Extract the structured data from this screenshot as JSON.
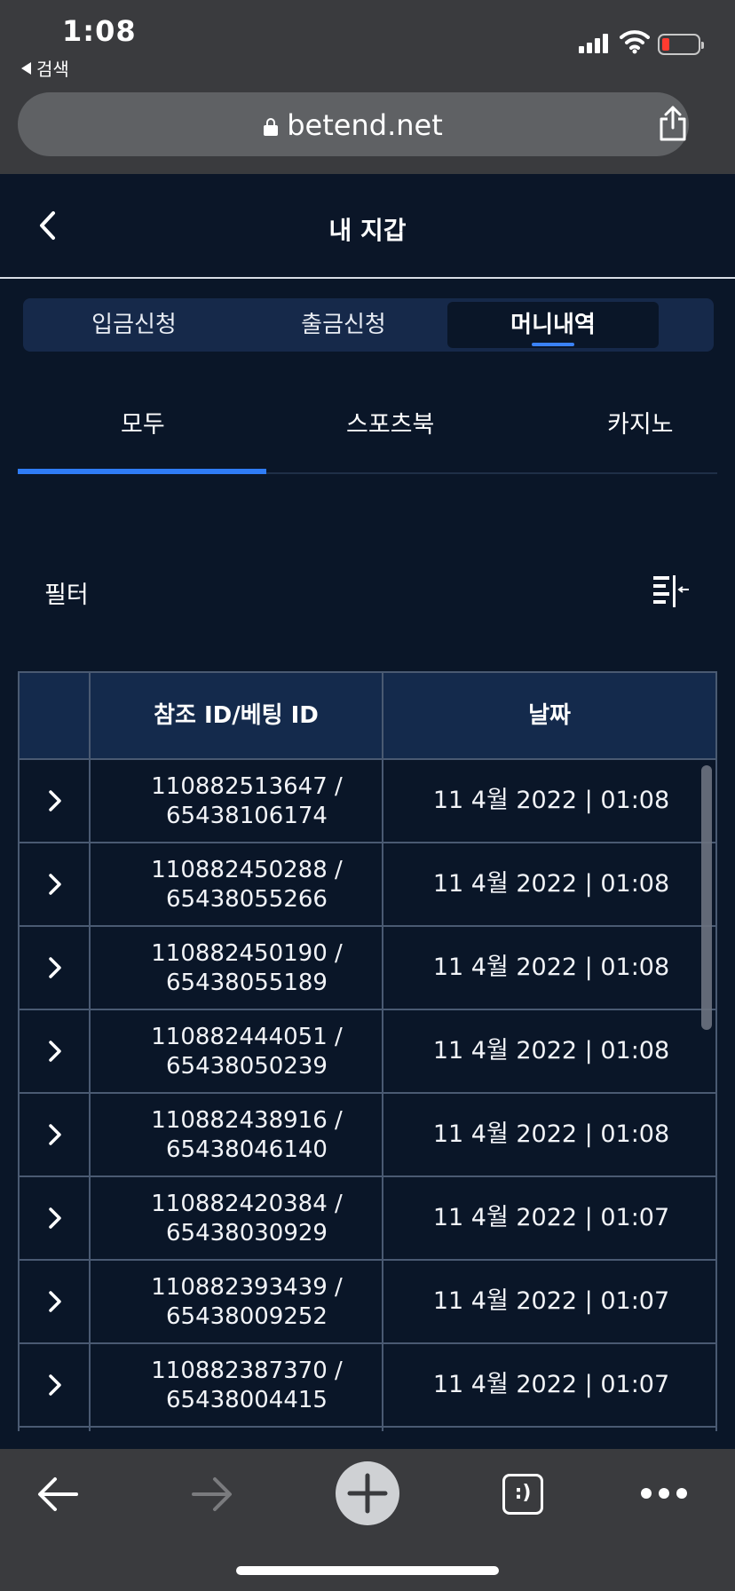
{
  "status_bar": {
    "time": "1:08",
    "back_app": "검색"
  },
  "browser": {
    "url": "betend.net"
  },
  "header": {
    "title": "내 지갑"
  },
  "wallet_tabs": [
    {
      "label": "입금신청",
      "active": false
    },
    {
      "label": "출금신청",
      "active": false
    },
    {
      "label": "머니내역",
      "active": true
    }
  ],
  "sub_tabs": [
    {
      "label": "모두",
      "active": true
    },
    {
      "label": "스포츠북",
      "active": false
    },
    {
      "label": "카지노",
      "active": false
    }
  ],
  "filter": {
    "label": "필터",
    "icon": "filter-collapse-icon"
  },
  "table": {
    "headers": [
      "",
      "참조 ID/베팅 ID",
      "날짜"
    ],
    "rows": [
      {
        "ref": "110882513647 /",
        "bet": "65438106174",
        "date": "11 4월 2022 | 01:08"
      },
      {
        "ref": "110882450288 /",
        "bet": "65438055266",
        "date": "11 4월 2022 | 01:08"
      },
      {
        "ref": "110882450190 /",
        "bet": "65438055189",
        "date": "11 4월 2022 | 01:08"
      },
      {
        "ref": "110882444051 /",
        "bet": "65438050239",
        "date": "11 4월 2022 | 01:08"
      },
      {
        "ref": "110882438916 /",
        "bet": "65438046140",
        "date": "11 4월 2022 | 01:08"
      },
      {
        "ref": "110882420384 /",
        "bet": "65438030929",
        "date": "11 4월 2022 | 01:07"
      },
      {
        "ref": "110882393439 /",
        "bet": "65438009252",
        "date": "11 4월 2022 | 01:07"
      },
      {
        "ref": "110882387370 /",
        "bet": "65438004415",
        "date": "11 4월 2022 | 01:07"
      }
    ]
  },
  "toolbar": {
    "tabs_label": ":)"
  },
  "colors": {
    "background": "#0a1628",
    "accent": "#2f7cf6",
    "table_header": "#142a4c",
    "browser_chrome": "#3a3b3e"
  }
}
